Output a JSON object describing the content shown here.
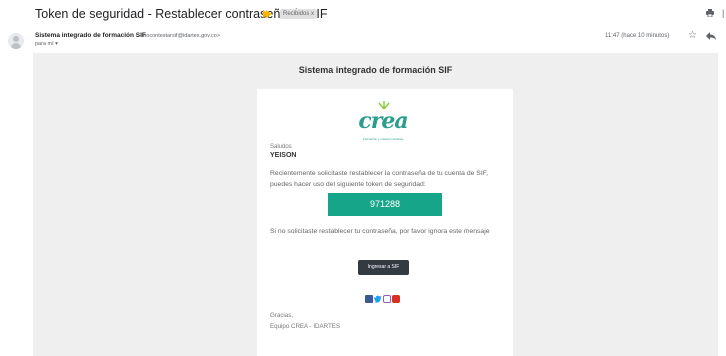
{
  "email": {
    "subject": "Token de seguridad - Restablecer contraseña de SIF",
    "label": "Recibidos x",
    "sender_name": "Sistema integrado de formación SIF",
    "sender_email": "<nocontestarsif@idartes.gov.co>",
    "to": "para mí ▾",
    "timestamp": "11:47 (hace 10 minutos)"
  },
  "body": {
    "header": "Sistema integrado de formación SIF",
    "logo_word": "crea",
    "logo_tagline": "Formación y creación artística",
    "greeting": "Saludos",
    "recipient_name": "YEISON",
    "paragraph1": "Recientemente solicitaste restablecer la contraseña de tu cuenta de SIF, puedes hacer uso del siguiente token de seguridad:",
    "token": "971288",
    "paragraph2": "Si no solicitaste restablecer tu contraseña, por favor ignora este mensaje",
    "button_label": "Ingresar a SIF",
    "thanks": "Gracias,",
    "signature": "Equipo CREA - IDARTES"
  },
  "icons": [
    "print-icon",
    "star-icon",
    "reply-icon",
    "facebook-icon",
    "twitter-icon",
    "instagram-icon",
    "youtube-icon"
  ],
  "colors": {
    "brand": "#2a9d8f",
    "token_bg": "#17a589",
    "button_bg": "#333a40",
    "email_bg": "#efefef",
    "important_marker": "#f4b400"
  }
}
